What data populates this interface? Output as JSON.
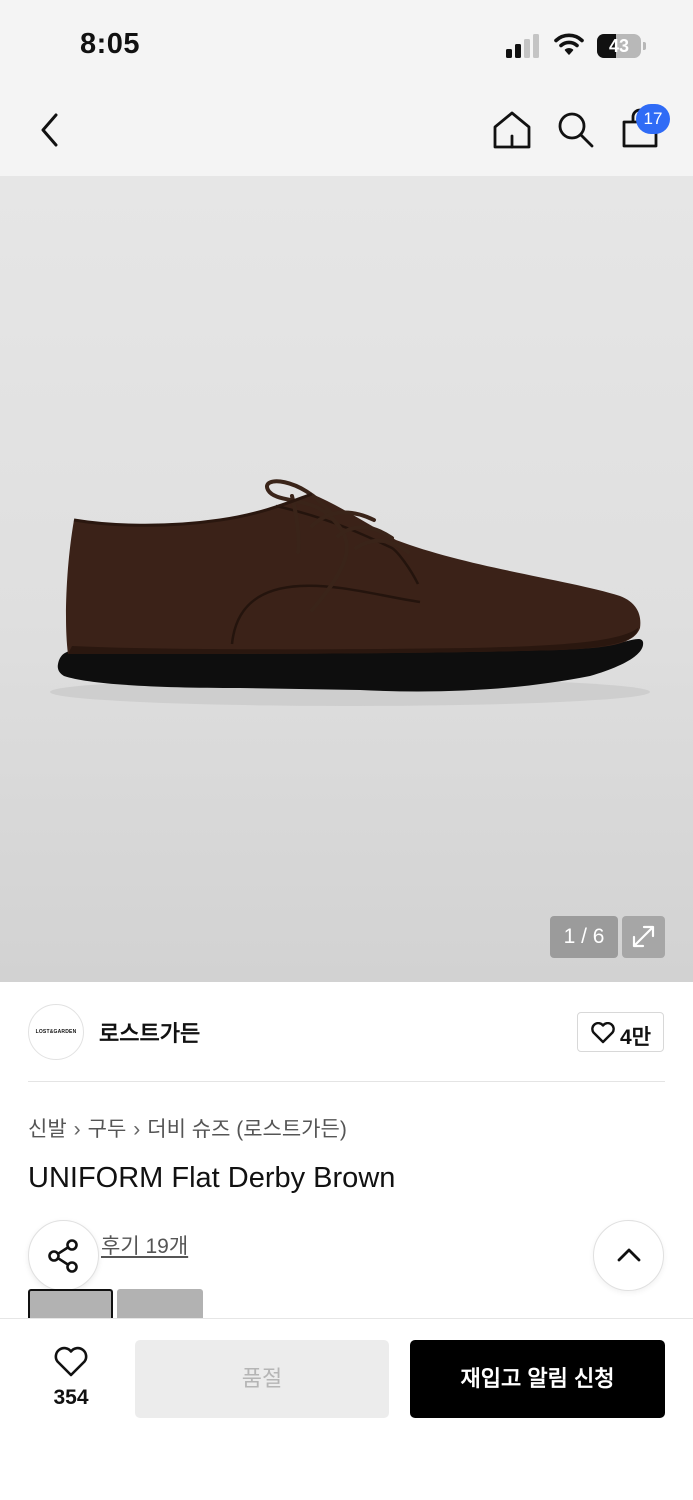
{
  "status_bar": {
    "time": "8:05",
    "battery_level": "43",
    "battery_fraction": 0.43,
    "signal_bars_active": 2,
    "signal_bars_total": 4
  },
  "nav": {
    "back_icon": "chevron-left-icon",
    "home_icon": "home-icon",
    "search_icon": "search-icon",
    "cart_icon": "shopping-bag-icon",
    "cart_count": "17",
    "badge_color": "#2f6bf6"
  },
  "gallery": {
    "counter": "1 / 6",
    "current": 1,
    "total": 6,
    "expand_icon": "expand-icon"
  },
  "brand": {
    "logo_text": "LOST&GARDEN",
    "name": "로스트가든",
    "like_icon": "heart-icon",
    "like_count": "4만"
  },
  "breadcrumb": [
    "신발",
    "구두",
    "더비 슈즈 (로스트가든)"
  ],
  "product": {
    "title": "UNIFORM Flat Derby Brown",
    "review_link": "후기 19개"
  },
  "floating": {
    "share_icon": "share-icon",
    "scroll_top_icon": "chevron-up-icon"
  },
  "bottom_bar": {
    "like_icon": "heart-icon",
    "like_count": "354",
    "soldout_label": "품절",
    "restock_label": "재입고 알림 신청"
  }
}
